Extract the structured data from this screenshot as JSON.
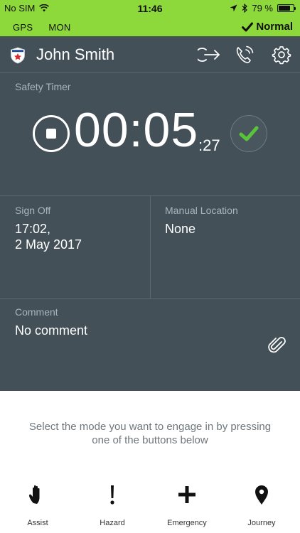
{
  "status_bar": {
    "carrier": "No SIM",
    "time": "11:46",
    "battery_text": "79 %",
    "battery_level": 0.79
  },
  "mode_bar": {
    "tag_gps": "GPS",
    "tag_mon": "MON",
    "status_label": "Normal"
  },
  "header": {
    "user_name": "John Smith"
  },
  "safety_timer": {
    "label": "Safety Timer",
    "main": "00:05",
    "seconds": ":27"
  },
  "sign_off": {
    "label": "Sign Off",
    "line1": "17:02,",
    "line2": "2 May 2017"
  },
  "manual_location": {
    "label": "Manual Location",
    "value": "None"
  },
  "comment": {
    "label": "Comment",
    "value": "No comment"
  },
  "instructions": {
    "line1": "Select the mode you want to engage in by pressing",
    "line2": "one of the buttons below"
  },
  "mode_buttons": [
    {
      "label": "Assist",
      "icon": "hand-icon"
    },
    {
      "label": "Hazard",
      "icon": "exclamation-icon"
    },
    {
      "label": "Emergency",
      "icon": "plus-icon"
    },
    {
      "label": "Journey",
      "icon": "map-pin-icon"
    }
  ],
  "colors": {
    "accent_green": "#8dd83a",
    "panel_bg": "#445058",
    "check_green": "#59c43a"
  }
}
